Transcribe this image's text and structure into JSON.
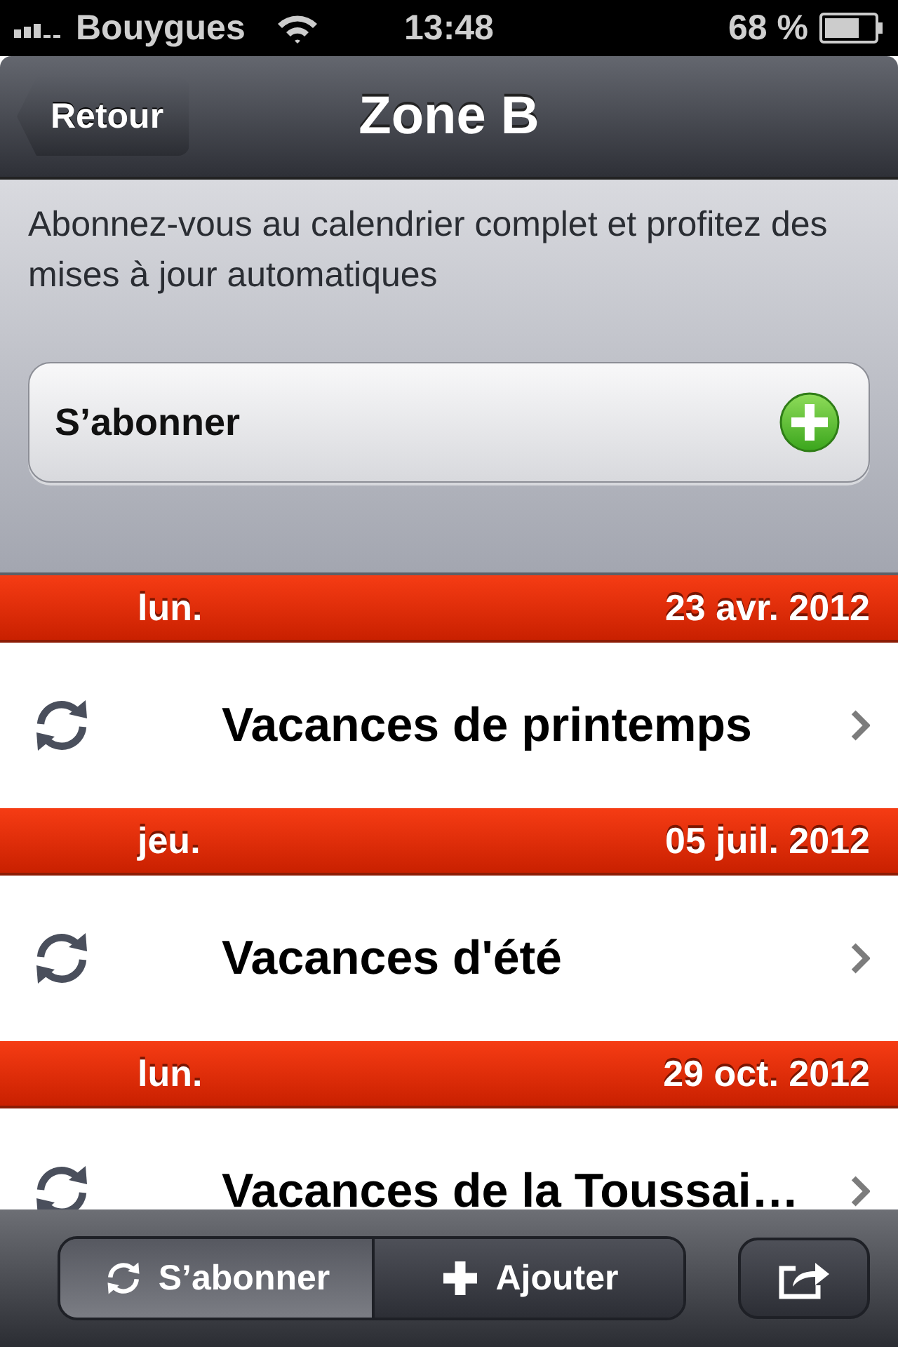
{
  "status_bar": {
    "carrier": "Bouygues",
    "time": "13:48",
    "battery": "68 %"
  },
  "nav_bar": {
    "back_button": "Retour",
    "title": "Zone B"
  },
  "subscribe_panel": {
    "message": "Abonnez-vous au calendrier complet et profitez des mises à jour automatiques",
    "button": "S’abonner"
  },
  "sections": [
    {
      "day": "lun.",
      "date": "23 avr. 2012",
      "events": [
        {
          "title": "Vacances de printemps"
        }
      ]
    },
    {
      "day": "jeu.",
      "date": "05 juil. 2012",
      "events": [
        {
          "title": "Vacances d'été"
        }
      ]
    },
    {
      "day": "lun.",
      "date": "29 oct. 2012",
      "events": [
        {
          "title": "Vacances de la Toussai…"
        }
      ]
    }
  ],
  "toolbar": {
    "segments": [
      {
        "label": "S’abonner",
        "kind": "sync",
        "selected": true
      },
      {
        "label": "Ajouter",
        "kind": "plus",
        "selected": false
      }
    ]
  }
}
